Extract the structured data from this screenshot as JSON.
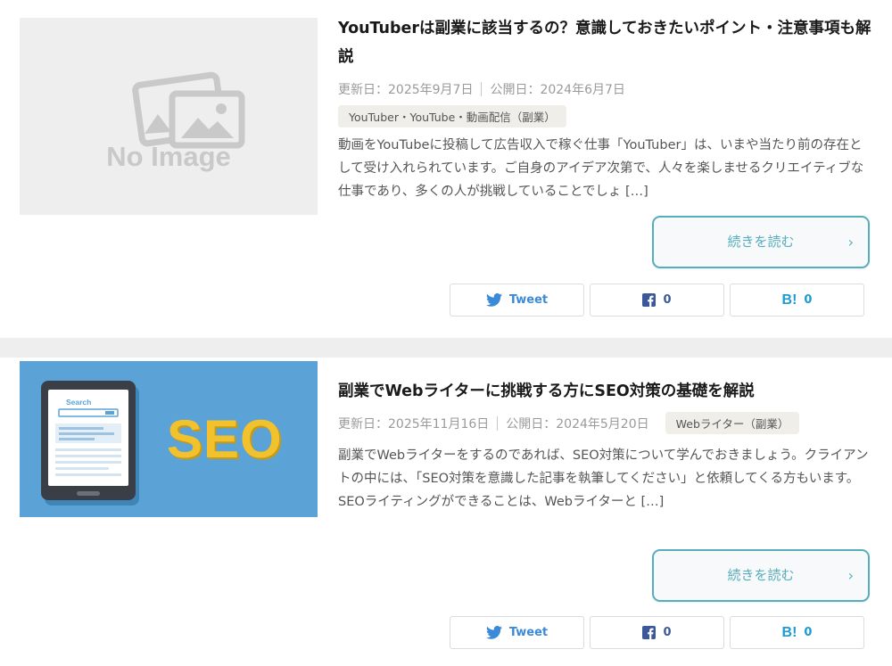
{
  "articles": [
    {
      "title": "YouTuberは副業に該当するの？意識しておきたいポイント・注意事項も解説",
      "updated": "更新日：2025年9月7日",
      "published": "公開日：2024年6月7日",
      "tag": "YouTuber・YouTube・動画配信（副業）",
      "excerpt": "動画をYouTubeに投稿して広告収入で稼ぐ仕事「YouTuber」は、いまや当たり前の存在として受け入れられています。ご自身のアイデア次第で、人々を楽しませるクリエイティブな仕事であり、多くの人が挑戦していることでしょ […]",
      "thumbnail_text": "No Image",
      "read_more": "続きを読む",
      "share": {
        "tweet_label": "Tweet",
        "facebook_count": "0",
        "hatena_count": "0"
      }
    },
    {
      "title": "副業でWebライターに挑戦する方にSEO対策の基礎を解説",
      "updated": "更新日：2025年11月16日",
      "published": "公開日：2024年5月20日",
      "tag": "Webライター（副業）",
      "excerpt": "副業でWebライターをするのであれば、SEO対策について学んでおきましょう。クライアントの中には、「SEO対策を意識した記事を執筆してください」と依頼してくる方もいます。SEOライティングができることは、Webライターと […]",
      "thumbnail_text": "SEO",
      "thumbnail_search_label": "Search",
      "read_more": "続きを読む",
      "share": {
        "tweet_label": "Tweet",
        "facebook_count": "0",
        "hatena_count": "0"
      }
    }
  ],
  "icons": {
    "twitter": "twitter-bird-icon",
    "facebook": "facebook-icon",
    "hatena": "hatena-bookmark-icon",
    "chevron": "chevron-right-icon"
  },
  "colors": {
    "accent": "#56aebd",
    "twitter": "#3b8ad8",
    "facebook": "#3b5998",
    "hatena": "#1d9bd1",
    "seo_yellow": "#f2c12e",
    "seo_bg": "#5ba3d6"
  }
}
